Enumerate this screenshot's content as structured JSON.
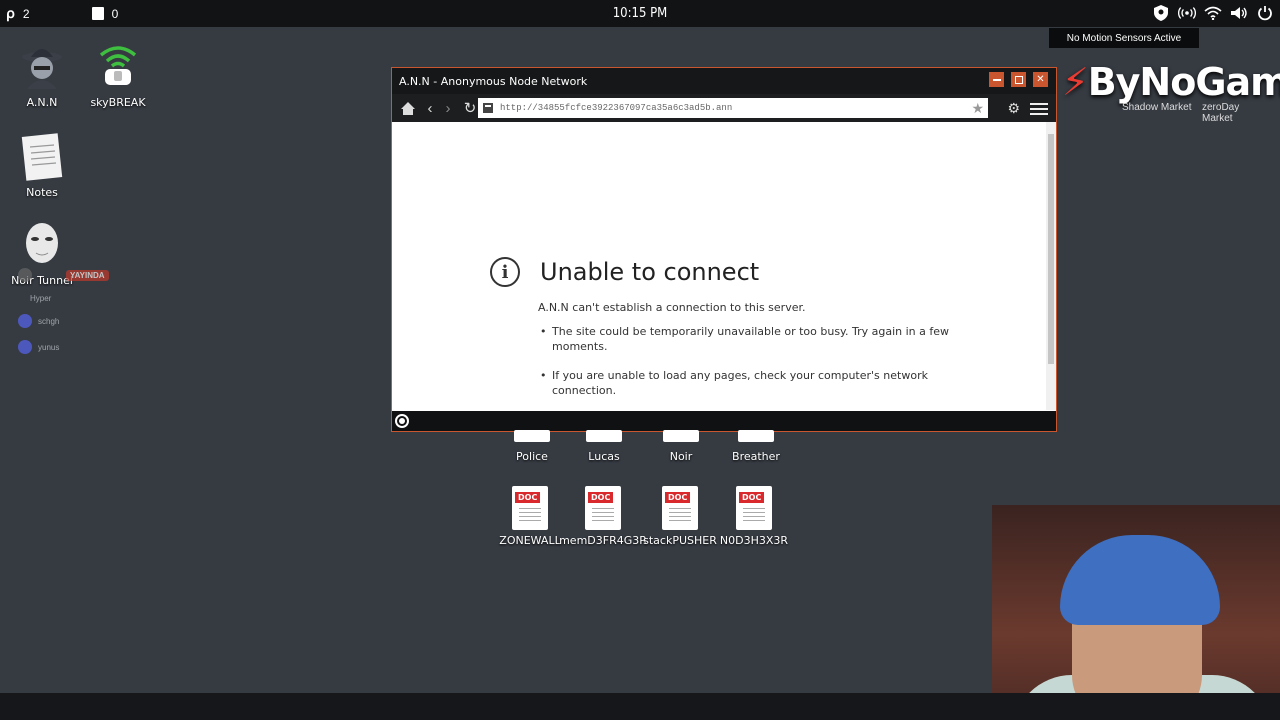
{
  "topbar": {
    "workspace_count": "2",
    "window_count": "0",
    "clock": "10:15 PM",
    "icons": [
      "shield-icon",
      "signal-icon",
      "wifi-icon",
      "volume-icon",
      "power-icon"
    ]
  },
  "sensor_label": "No Motion Sensors Active",
  "desktop_icons": [
    {
      "label": "A.N.N"
    },
    {
      "label": "skyBREAK"
    },
    {
      "label": "Notes"
    },
    {
      "label": "Noir Tunnel"
    }
  ],
  "chat_overlay": {
    "badge": "YAYINDA",
    "users": [
      "Hyper",
      "schgh",
      "yunus"
    ]
  },
  "brand": {
    "name": "ByNoGame",
    "shortcuts": [
      "Shadow Market",
      "zeroDay Market"
    ]
  },
  "browser": {
    "title": "A.N.N - Anonymous Node Network",
    "url": "http://34855fcfce3922367097ca35a6c3ad5b.ann",
    "error": {
      "title": "Unable to connect",
      "description": "A.N.N can't establish a connection to this server.",
      "bullets": [
        "The site could be temporarily unavailable or too busy. Try again in a few moments.",
        "If you are unable to load any pages, check your computer's network connection."
      ]
    }
  },
  "files": [
    {
      "label": "Police"
    },
    {
      "label": "Lucas"
    },
    {
      "label": "Noir"
    },
    {
      "label": "Breather"
    },
    {
      "label": "ZONEWALL",
      "tag": "DOC"
    },
    {
      "label": "memD3FR4G3R",
      "tag": "DOC"
    },
    {
      "label": "stackPUSHER",
      "tag": "DOC"
    },
    {
      "label": "N0D3H3X3R",
      "tag": "DOC"
    }
  ],
  "colors": {
    "accent": "#c9562f",
    "desktop_bg": "#363b42",
    "brand_red": "#ea3b32"
  }
}
